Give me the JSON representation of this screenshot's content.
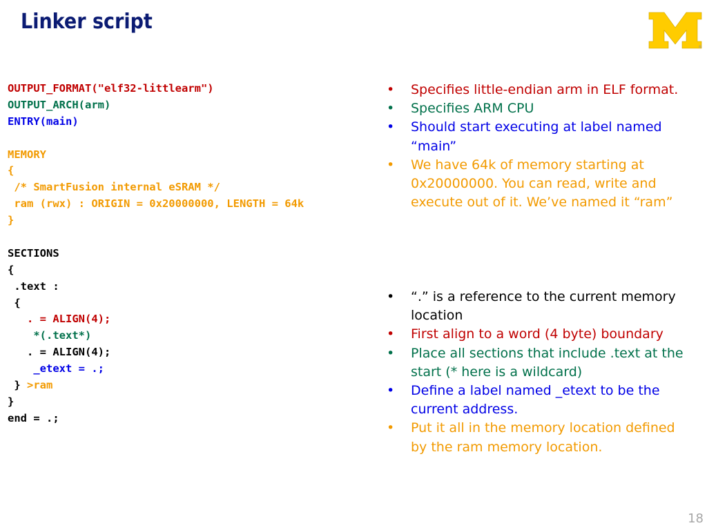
{
  "slide": {
    "title": "Linker script",
    "page_number": "18",
    "logo_letter": "M"
  },
  "colors": {
    "title": "#0b1b73",
    "red": "#c00000",
    "green": "#00704a",
    "blue": "#0000e6",
    "orange": "#f29a00",
    "black": "#000000",
    "logo_gold": "#ffcc00"
  },
  "code_lines": [
    {
      "text": "OUTPUT_FORMAT(\"elf32-littlearm\")",
      "color": "#c00000"
    },
    {
      "text": "OUTPUT_ARCH(arm)",
      "color": "#00704a"
    },
    {
      "text": "ENTRY(main)",
      "color": "#0000e6"
    },
    {
      "text": "",
      "color": "#000000"
    },
    {
      "text": "MEMORY",
      "color": "#f29a00"
    },
    {
      "text": "{",
      "color": "#f29a00"
    },
    {
      "text": " /* SmartFusion internal eSRAM */",
      "color": "#f29a00"
    },
    {
      "text": " ram (rwx) : ORIGIN = 0x20000000, LENGTH = 64k",
      "color": "#f29a00"
    },
    {
      "text": "}",
      "color": "#f29a00"
    },
    {
      "text": "",
      "color": "#000000"
    },
    {
      "text": "SECTIONS",
      "color": "#000000"
    },
    {
      "text": "{",
      "color": "#000000"
    },
    {
      "text": " .text :",
      "color": "#000000"
    },
    {
      "text": " {",
      "color": "#000000"
    },
    {
      "text": "   . = ALIGN(4);",
      "color": "#c00000"
    },
    {
      "text": "    *(.text*)",
      "color": "#00704a"
    },
    {
      "text": "   . = ALIGN(4);",
      "color": "#000000"
    },
    {
      "text": "    _etext = .;",
      "color": "#0000e6"
    },
    {
      "text": " } ",
      "color": "#000000",
      "suffix": ">ram",
      "suffix_color": "#f29a00"
    },
    {
      "text": "}",
      "color": "#000000"
    },
    {
      "text": "end = .;",
      "color": "#000000"
    }
  ],
  "bullets_top": [
    {
      "text": "Specifies little-endian arm in ELF format.",
      "color": "#c00000"
    },
    {
      "text": "Specifies ARM CPU",
      "color": "#00704a"
    },
    {
      "text": "Should start executing at label named “main”",
      "color": "#0000e6"
    },
    {
      "text": "We have 64k of memory starting at 0x20000000.  You can read, write and execute out of it.  We’ve named it “ram”",
      "color": "#f29a00"
    }
  ],
  "bullets_bottom": [
    {
      "text": "“.” is a reference to the current memory location",
      "color": "#000000"
    },
    {
      "text": "First align to a word (4 byte) boundary",
      "color": "#c00000"
    },
    {
      "text": "Place all sections that include .text at the start (* here is a wildcard)",
      "color": "#00704a"
    },
    {
      "text": "Define a label named _etext to be the current address.",
      "color": "#0000e6"
    },
    {
      "text": "Put it all in the memory location defined by the ram memory location.",
      "color": "#f29a00"
    }
  ]
}
